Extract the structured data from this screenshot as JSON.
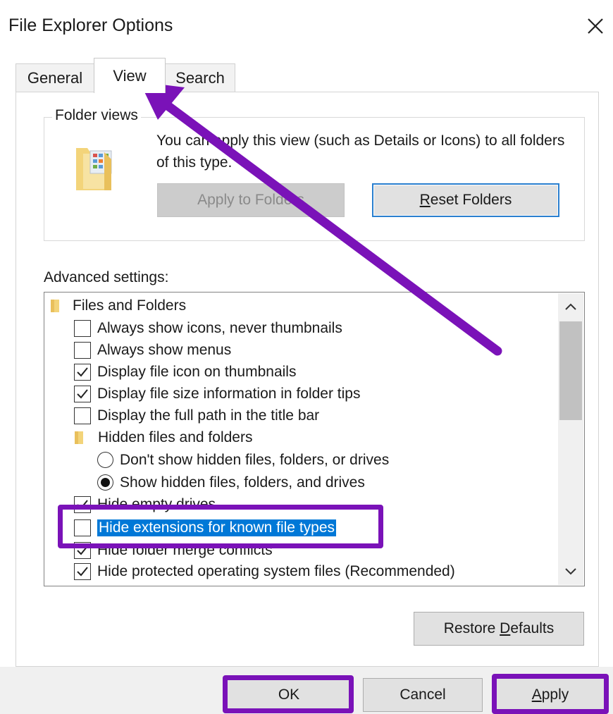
{
  "window": {
    "title": "File Explorer Options",
    "close_glyph": "✕"
  },
  "tabs": [
    {
      "label": "General"
    },
    {
      "label": "View"
    },
    {
      "label": "Search"
    }
  ],
  "folder_views": {
    "group_label": "Folder views",
    "description": "You can apply this view (such as Details or Icons) to all folders of this type.",
    "apply_to_folders": "Apply to Folders",
    "reset_folders_underlined": "R",
    "reset_folders_rest": "eset Folders"
  },
  "advanced": {
    "label": "Advanced settings:",
    "items": [
      {
        "type": "folder",
        "text": "Files and Folders"
      },
      {
        "type": "checkbox",
        "checked": false,
        "text": "Always show icons, never thumbnails"
      },
      {
        "type": "checkbox",
        "checked": false,
        "text": "Always show menus"
      },
      {
        "type": "checkbox",
        "checked": true,
        "text": "Display file icon on thumbnails"
      },
      {
        "type": "checkbox",
        "checked": true,
        "text": "Display file size information in folder tips"
      },
      {
        "type": "checkbox",
        "checked": false,
        "text": "Display the full path in the title bar"
      },
      {
        "type": "folder",
        "text": "Hidden files and folders"
      },
      {
        "type": "radio",
        "selected": false,
        "text": "Don't show hidden files, folders, or drives"
      },
      {
        "type": "radio",
        "selected": true,
        "text": "Show hidden files, folders, and drives"
      },
      {
        "type": "checkbox",
        "checked": true,
        "text": "Hide empty drives"
      },
      {
        "type": "checkbox",
        "checked": false,
        "text": "Hide extensions for known file types",
        "highlighted": true
      },
      {
        "type": "checkbox",
        "checked": true,
        "text": "Hide folder merge conflicts"
      },
      {
        "type": "checkbox",
        "checked": true,
        "text": "Hide protected operating system files (Recommended)"
      }
    ]
  },
  "restore_defaults": {
    "before": "Restore ",
    "underlined": "D",
    "after": "efaults"
  },
  "footer": {
    "ok": "OK",
    "cancel": "Cancel",
    "apply_underlined": "A",
    "apply_rest": "pply"
  },
  "colors": {
    "annotation": "#7a12b8",
    "selection": "#0078d7",
    "focus_border": "#2a7fcf"
  }
}
